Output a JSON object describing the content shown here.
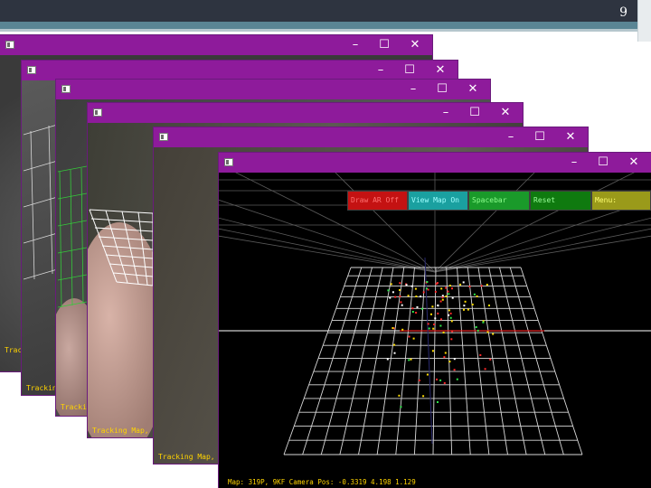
{
  "slide": {
    "page_number": "9"
  },
  "windows": [
    {
      "status": "Trac"
    },
    {
      "status": "Trackin"
    },
    {
      "status": "Tracki"
    },
    {
      "status": "Tracking Map,"
    },
    {
      "status": "Tracking Map,"
    }
  ],
  "title_bar": {
    "minimize": "–",
    "maximize": "☐",
    "close": "✕"
  },
  "map_window": {
    "menu": [
      {
        "label": "Draw AR Off",
        "bg": "#c41212",
        "fg": "#ff7070"
      },
      {
        "label": "View Map On",
        "bg": "#1aa0a0",
        "fg": "#9fffff"
      },
      {
        "label": "Spacebar",
        "bg": "#1a9a2a",
        "fg": "#8dff8d"
      },
      {
        "label": "Reset",
        "bg": "#0f7a0f",
        "fg": "#9bff9b"
      },
      {
        "label": "Menu:",
        "bg": "#9a9a1a",
        "fg": "#ffff70"
      }
    ],
    "status": "Map: 319P, 9KF    Camera Pos: -0.3319 4.198 1.129"
  },
  "colors": {
    "titlebar": "#8e1b9b",
    "accent": "#5a8594",
    "status_text": "#ffd400"
  }
}
